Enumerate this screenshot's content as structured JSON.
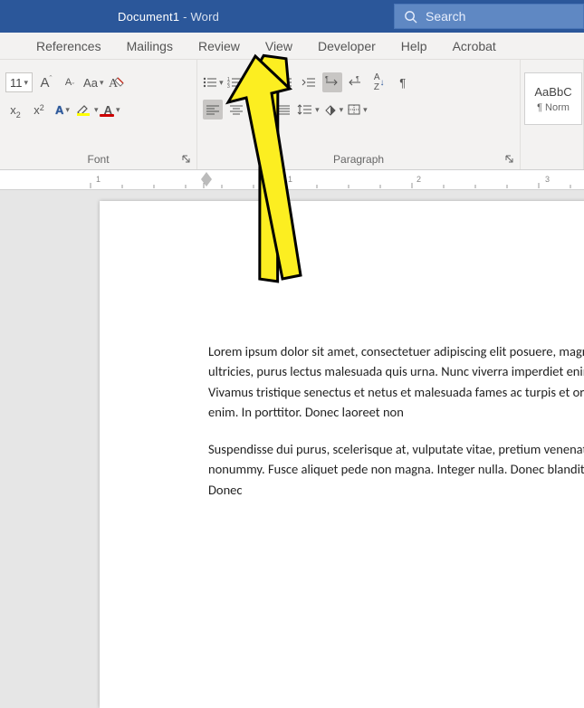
{
  "titlebar": {
    "document_name": "Document1",
    "separator": "  -  ",
    "app_name": "Word",
    "search_placeholder": "Search"
  },
  "tabs": {
    "references": "References",
    "mailings": "Mailings",
    "review": "Review",
    "view": "View",
    "developer": "Developer",
    "help": "Help",
    "acrobat": "Acrobat"
  },
  "ribbon": {
    "font": {
      "size_value": "11",
      "grow_font": "A",
      "shrink_font": "A",
      "change_case": "Aa",
      "clear_fmt": "A",
      "subscript": "x",
      "superscript": "x",
      "text_effects": "A",
      "highlight": "",
      "font_color": "A",
      "label": "Font"
    },
    "paragraph": {
      "sort": "A↓Z",
      "show_marks": "¶",
      "label": "Paragraph"
    },
    "styles": {
      "tile_sample": "AaBbC",
      "tile_name": "¶ Norm"
    }
  },
  "ruler": {
    "n1": "1",
    "n2": "1",
    "n3": "2",
    "n4": "3"
  },
  "document": {
    "p1": "Lorem ipsum dolor sit amet, consectetuer adipiscing elit posuere, magna sed pulvinar ultricies, purus lectus malesuada quis urna. Nunc viverra imperdiet enim. Fusce est. Vivamus tristique senectus et netus et malesuada fames ac turpis et orci. Aenean nec enim. In porttitor. Donec laoreet non",
    "p2": "Suspendisse dui purus, scelerisque at, vulputate vitae, pretium venenatis eleifend. Ut nonummy. Fusce aliquet pede non magna. Integer nulla. Donec blandit feugiat ligula. Donec"
  }
}
